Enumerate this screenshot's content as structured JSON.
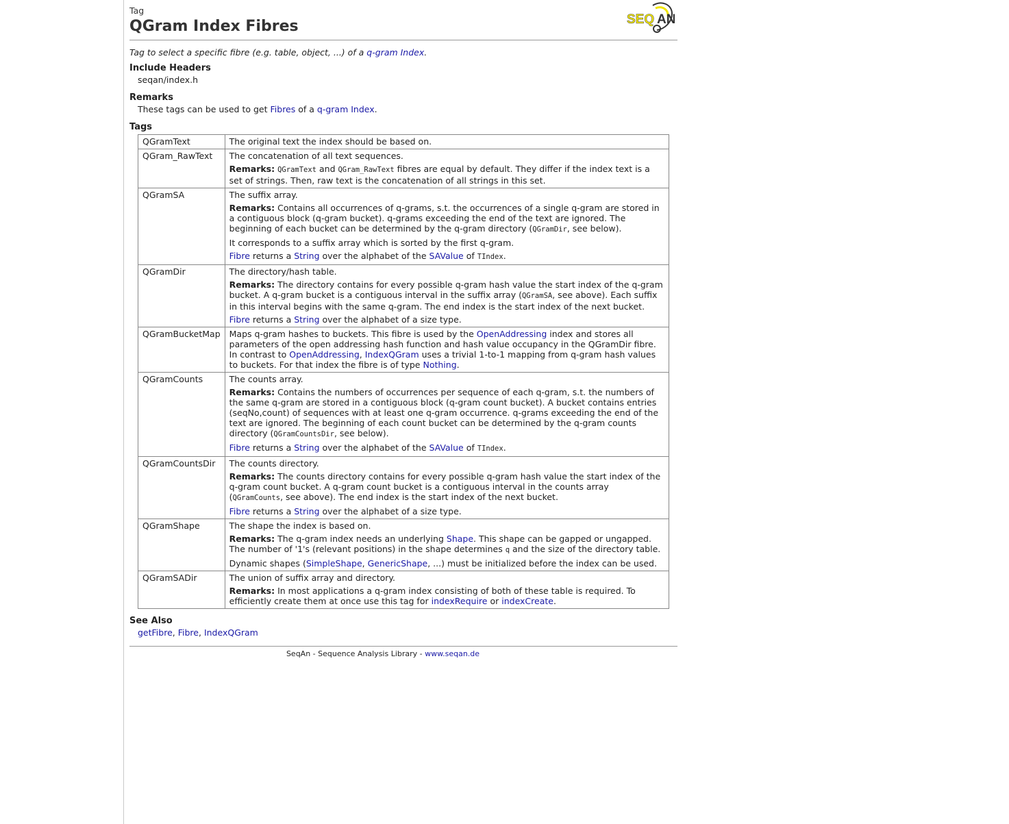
{
  "header": {
    "kind": "Tag",
    "title": "QGram Index Fibres",
    "logo_text": "SEQAN"
  },
  "summary": {
    "pre": "Tag to select a specific fibre (e.g. table, object, ...) of a ",
    "link": "q-gram Index",
    "post": "."
  },
  "include": {
    "title": "Include Headers",
    "file": "seqan/index.h"
  },
  "remarks": {
    "title": "Remarks",
    "pre": "These tags can be used to get ",
    "link1": "Fibres",
    "mid": " of a ",
    "link2": "q-gram Index",
    "post": "."
  },
  "tags": {
    "title": "Tags",
    "common": {
      "remarks_label": "Remarks:",
      "fibre": "Fibre",
      "returns_a": " returns a ",
      "string": "String",
      "over_savalue": " over the alphabet of the ",
      "savalue": "SAValue",
      "of": " of ",
      "tindex": "TIndex",
      "dot": ".",
      "size_type": " over the alphabet of a size type."
    },
    "qgramtext": {
      "name": "QGramText",
      "desc": "The original text the index should be based on."
    },
    "rawtext": {
      "name": "QGram_RawText",
      "desc": "The concatenation of all text sequences.",
      "c1": "QGramText",
      "and": " and ",
      "c2": "QGram_RawText",
      "rem": " fibres are equal by default. They differ if the index text is a set of strings. Then, raw text is the concatenation of all strings in this set."
    },
    "sa": {
      "name": "QGramSA",
      "desc": "The suffix array.",
      "rem": " Contains all occurrences of q-grams, s.t. the occurrences of a single q-gram are stored in a contiguous block (q-gram bucket). q-grams exceeding the end of the text are ignored. The beginning of each bucket can be determined by the q-gram directory (",
      "code": "QGramDir",
      "rem_end": ", see below).",
      "extra": "It corresponds to a suffix array which is sorted by the first q-gram."
    },
    "dir": {
      "name": "QGramDir",
      "desc": "The directory/hash table.",
      "rem": " The directory contains for every possible q-gram hash value the start index of the q-gram bucket. A q-gram bucket is a contiguous interval in the suffix array (",
      "code": "QGramSA",
      "rem_end": ", see above). Each suffix in this interval begins with the same q-gram. The end index is the start index of the next bucket."
    },
    "bucketmap": {
      "name": "QGramBucketMap",
      "pre": "Maps q-gram hashes to buckets. This fibre is used by the ",
      "l1": "OpenAddressing",
      "mid1": " index and stores all parameters of the open addressing hash function and hash value occupancy in the QGramDir fibre. In contrast to ",
      "l2": "OpenAddressing",
      "comma": ", ",
      "l3": "IndexQGram",
      "mid2": " uses a trivial 1-to-1 mapping from q-gram hash values to buckets. For that index the fibre is of type ",
      "l4": "Nothing",
      "post": "."
    },
    "counts": {
      "name": "QGramCounts",
      "desc": "The counts array.",
      "rem": " Contains the numbers of occurrences per sequence of each q-gram, s.t. the numbers of the same q-gram are stored in a contiguous block (q-gram count bucket). A bucket contains entries (seqNo,count) of sequences with at least one q-gram occurrence. q-grams exceeding the end of the text are ignored. The beginning of each count bucket can be determined by the q-gram counts directory (",
      "code": "QGramCountsDir",
      "rem_end": ", see below)."
    },
    "countsdir": {
      "name": "QGramCountsDir",
      "desc": "The counts directory.",
      "rem": " The counts directory contains for every possible q-gram hash value the start index of the q-gram count bucket. A q-gram count bucket is a contiguous interval in the counts array (",
      "code": "QGramCounts",
      "rem_end": ", see above). The end index is the start index of the next bucket."
    },
    "shape": {
      "name": "QGramShape",
      "desc": "The shape the index is based on.",
      "rem": " The q-gram index needs an underlying ",
      "l1": "Shape",
      "rem2": ". This shape can be gapped or ungapped. The number of '1's (relevant positions) in the shape determines ",
      "code": "q",
      "rem3": " and the size of the directory table.",
      "dyn_pre": "Dynamic shapes (",
      "l2": "SimpleShape",
      "comma": ", ",
      "l3": "GenericShape",
      "dyn_post": ", ...) must be initialized before the index can be used."
    },
    "sadir": {
      "name": "QGramSADir",
      "desc": "The union of suffix array and directory.",
      "rem": " In most applications a q-gram index consisting of both of these table is required. To efficiently create them at once use this tag for ",
      "l1": "indexRequire",
      "or": " or ",
      "l2": "indexCreate",
      "post": "."
    }
  },
  "see_also": {
    "title": "See Also",
    "l1": "getFibre",
    "sep": ", ",
    "l2": "Fibre",
    "l3": "IndexQGram"
  },
  "footer": {
    "text": "SeqAn - Sequence Analysis Library - ",
    "link": "www.seqan.de"
  },
  "colors": {
    "link": "#1a1aa6",
    "text": "#222222",
    "logo_yellow": "#f2e600"
  }
}
